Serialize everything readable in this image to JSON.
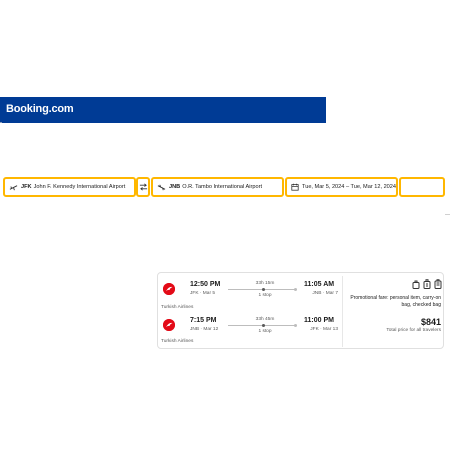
{
  "header": {
    "logo": "Booking.com",
    "brand_color": "#003b95"
  },
  "search": {
    "origin_code": "JFK",
    "origin_name": "John F. Kennedy International Airport",
    "destination_code": "JNB",
    "destination_name": "O.R. Tambo International Airport",
    "dates": "Tue, Mar 5, 2024 – Tue, Mar 12, 2024",
    "accent_color": "#ffb700",
    "icons": {
      "origin": "plane-takeoff-icon",
      "swap": "swap-arrows-icon",
      "destination": "plane-landing-icon",
      "dates": "calendar-icon"
    }
  },
  "result": {
    "legs": [
      {
        "airline": "Turkish Airlines",
        "depart_time": "12:50 PM",
        "depart_sub": "JFK · Mar 5",
        "duration": "33h 15m",
        "stops": "1 stop",
        "arrive_time": "11:05 AM",
        "arrive_sub": "JNB · Mar 7"
      },
      {
        "airline": "Turkish Airlines",
        "depart_time": "7:15 PM",
        "depart_sub": "JNB · Mar 12",
        "duration": "33h 45m",
        "stops": "1 stop",
        "arrive_time": "11:00 PM",
        "arrive_sub": "JFK · Mar 13"
      }
    ],
    "bag_icons": [
      "personal-item-icon",
      "carry-on-bag-icon",
      "checked-bag-icon"
    ],
    "fare_note": "Promotional fare: personal item, carry-on bag, checked bag",
    "price": "$841",
    "price_note": "Total price for all travelers",
    "airline_color": "#e30a17"
  }
}
